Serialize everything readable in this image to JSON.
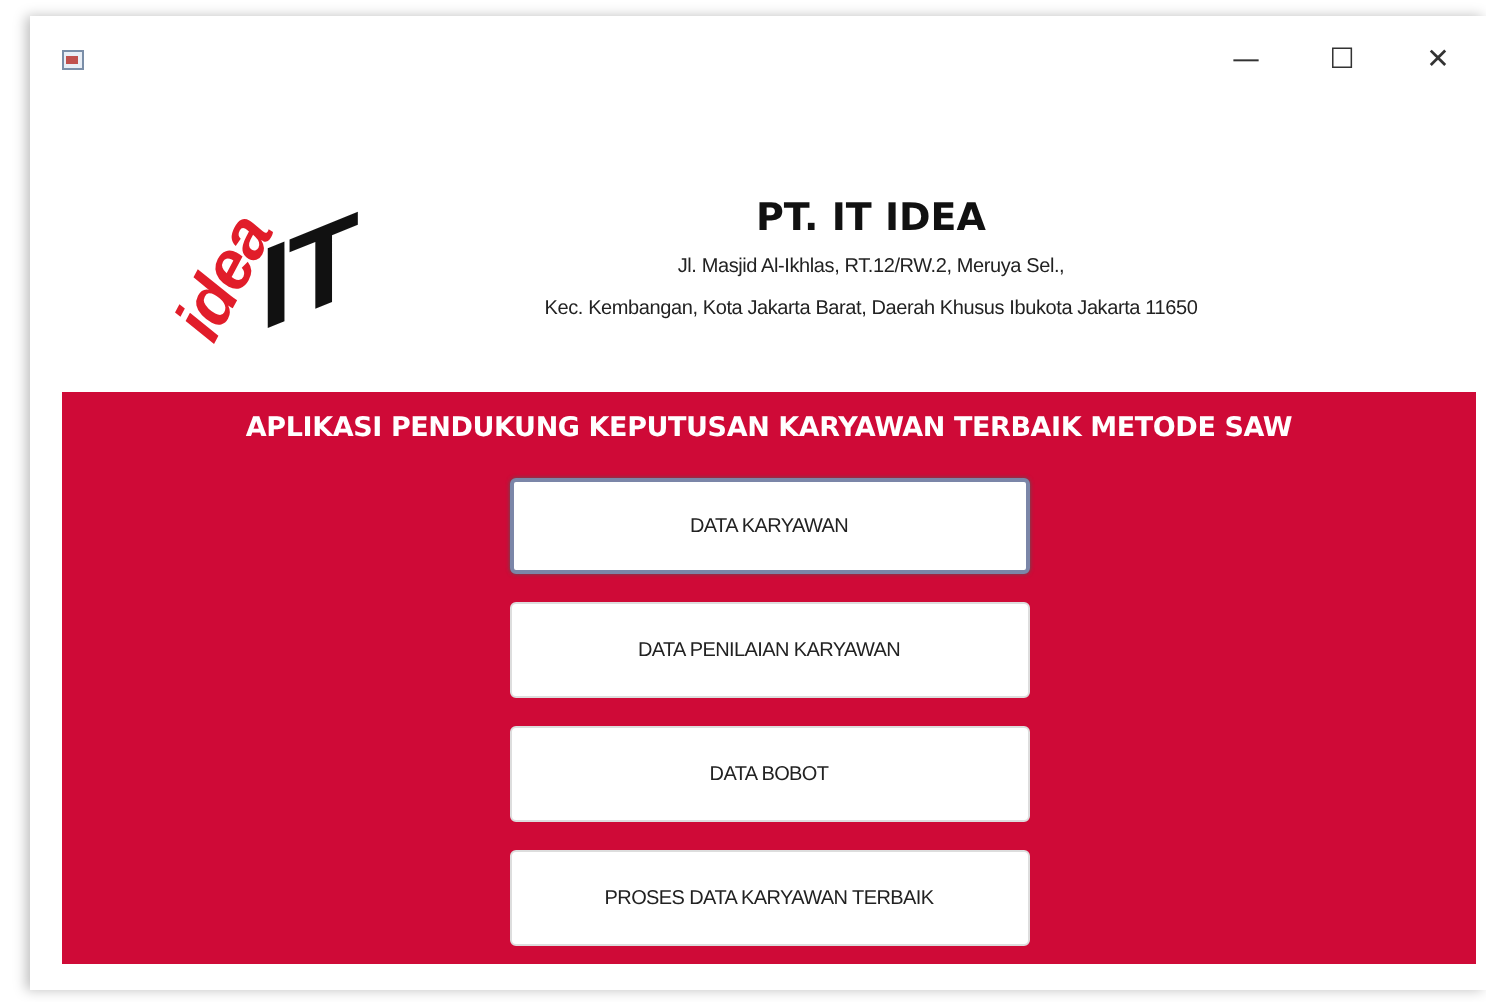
{
  "window": {
    "controls": [
      "—",
      "☐",
      "✕"
    ]
  },
  "logo": {
    "word": "idea",
    "letters": "IT"
  },
  "company": {
    "name": "PT. IT IDEA",
    "address_lines": [
      "Jl. Masjid Al-Ikhlas, RT.12/RW.2, Meruya Sel.,",
      "Kec. Kembangan, Kota Jakarta Barat, Daerah Khusus Ibukota Jakarta 11650"
    ]
  },
  "panel": {
    "title": "APLIKASI PENDUKUNG KEPUTUSAN KARYAWAN TERBAIK METODE SAW",
    "buttons": [
      {
        "label": "DATA KARYAWAN",
        "selected": true
      },
      {
        "label": "DATA PENILAIAN KARYAWAN",
        "selected": false
      },
      {
        "label": "DATA BOBOT",
        "selected": false
      },
      {
        "label": "PROSES DATA KARYAWAN TERBAIK",
        "selected": false
      }
    ]
  }
}
